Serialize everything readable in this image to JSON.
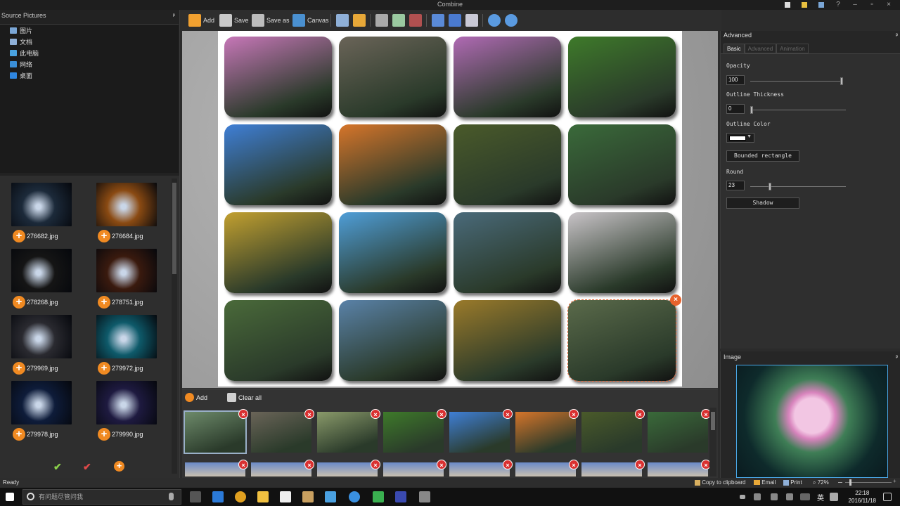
{
  "window": {
    "title": "Combine"
  },
  "source_panel": {
    "title": "Source Pictures",
    "pin": "⁀",
    "tree": [
      {
        "label": "图片",
        "icon": "pictures-folder-icon",
        "color": "#7aa6d6"
      },
      {
        "label": "文档",
        "icon": "documents-folder-icon",
        "color": "#8fb0d8"
      },
      {
        "label": "此电脑",
        "icon": "computer-icon",
        "color": "#4aa3e0"
      },
      {
        "label": "网络",
        "icon": "network-icon",
        "color": "#3a8fd8"
      },
      {
        "label": "桌面",
        "icon": "desktop-icon",
        "color": "#2f86e0"
      }
    ]
  },
  "thumbnails": [
    {
      "name": "276682.jpg",
      "color": "#1c2a3a"
    },
    {
      "name": "276684.jpg",
      "color": "#8a4a12"
    },
    {
      "name": "278268.jpg",
      "color": "#151515"
    },
    {
      "name": "278751.jpg",
      "color": "#3a1a0e"
    },
    {
      "name": "279969.jpg",
      "color": "#2a2a30"
    },
    {
      "name": "279972.jpg",
      "color": "#0e5a6a"
    },
    {
      "name": "279978.jpg",
      "color": "#0e1c3a"
    },
    {
      "name": "279990.jpg",
      "color": "#1e1a40"
    }
  ],
  "toolbar": {
    "add": "Add",
    "save": "Save",
    "save_as": "Save as",
    "canvas": "Canvas"
  },
  "canvas_cells": [
    "#c777b8",
    "#6a6458",
    "#b06ab4",
    "#3e7a2a",
    "#3f7fd6",
    "#d6752a",
    "#4a5a2a",
    "#3a6a3a",
    "#c2a030",
    "#4f9ed8",
    "#4a6a7a",
    "#c9c4c8",
    "#4a6a3a",
    "#5a82a8",
    "#9a7a2a",
    "#5a6a4a"
  ],
  "strip": {
    "add": "Add",
    "clear_all": "Clear all",
    "items": [
      "#6d8a6a",
      "#6a6458",
      "#8a9a6a",
      "#3e7a2a",
      "#3f7fd6",
      "#d6752a",
      "#4a5a2a",
      "#3a6a3a"
    ]
  },
  "right_panel": {
    "title": "Advanced",
    "tabs": [
      "Basic",
      "Advanced",
      "Animation"
    ],
    "opacity_label": "Opacity",
    "opacity_value": "100",
    "opacity_fraction": 1.0,
    "outline_thickness_label": "Outline Thickness",
    "outline_thickness_value": "0",
    "outline_color_label": "Outline Color",
    "shape_button": "Bounded rectangle",
    "round_label": "Round",
    "round_value": "23",
    "round_fraction": 0.2,
    "shadow_button": "Shadow"
  },
  "image_panel": {
    "title": "Image"
  },
  "status": {
    "ready": "Ready",
    "copy": "Copy to clipboard",
    "email": "Email",
    "print": "Print",
    "zoom": "72%"
  },
  "taskbar": {
    "search_placeholder": "有问题尽管问我",
    "lang": "英",
    "time": "22:18",
    "date": "2016/11/18"
  }
}
